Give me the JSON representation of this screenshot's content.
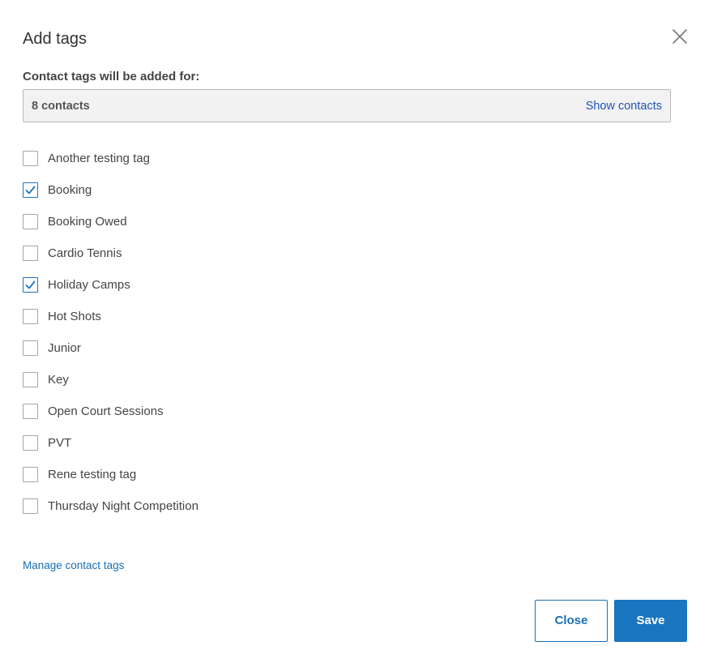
{
  "dialog": {
    "title": "Add tags",
    "close_icon": "close-icon"
  },
  "contacts": {
    "heading": "Contact tags will be added for:",
    "count_label": "8 contacts",
    "show_link": "Show contacts"
  },
  "tags": [
    {
      "label": "Another testing tag",
      "checked": false
    },
    {
      "label": "Booking",
      "checked": true
    },
    {
      "label": "Booking Owed",
      "checked": false
    },
    {
      "label": "Cardio Tennis",
      "checked": false
    },
    {
      "label": "Holiday Camps",
      "checked": true
    },
    {
      "label": "Hot Shots",
      "checked": false
    },
    {
      "label": "Junior",
      "checked": false
    },
    {
      "label": "Key",
      "checked": false
    },
    {
      "label": "Open Court Sessions",
      "checked": false
    },
    {
      "label": "PVT",
      "checked": false
    },
    {
      "label": "Rene testing tag",
      "checked": false
    },
    {
      "label": "Thursday Night Competition",
      "checked": false
    }
  ],
  "manage_link": "Manage contact tags",
  "buttons": {
    "close_label": "Close",
    "save_label": "Save"
  },
  "colors": {
    "accent": "#1a75c1",
    "link": "#1a6fb5",
    "show_contacts_link": "#1f53b5",
    "box_background": "#f2f2f2"
  }
}
